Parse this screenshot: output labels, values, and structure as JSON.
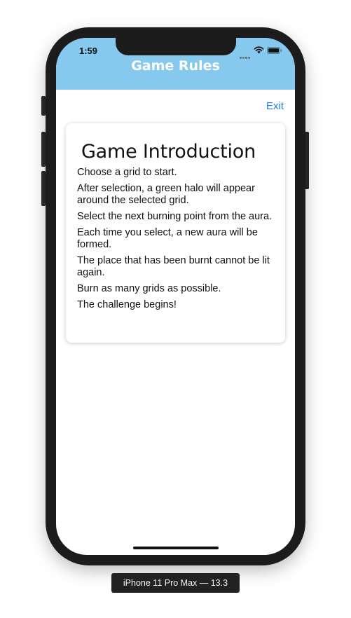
{
  "status_bar": {
    "time": "1:59"
  },
  "navbar": {
    "title": "Game Rules",
    "background": "#87c8ee",
    "exit_label": "Exit",
    "exit_color": "#1d7ed8"
  },
  "card": {
    "title": "Game Introduction",
    "rules": [
      "Choose a grid to start.",
      "After selection, a green halo will appear around the selected grid.",
      "Select the next burning point from the aura.",
      "Each time you select, a new aura will be formed.",
      "The place that has been burnt cannot be lit again.",
      "Burn as many grids as possible.",
      "The challenge begins!"
    ]
  },
  "simulator": {
    "device_label": "iPhone 11 Pro Max — 13.3"
  },
  "icons": {
    "wifi": "wifi-icon",
    "battery": "battery-icon",
    "signal": "signal-dots-icon"
  }
}
